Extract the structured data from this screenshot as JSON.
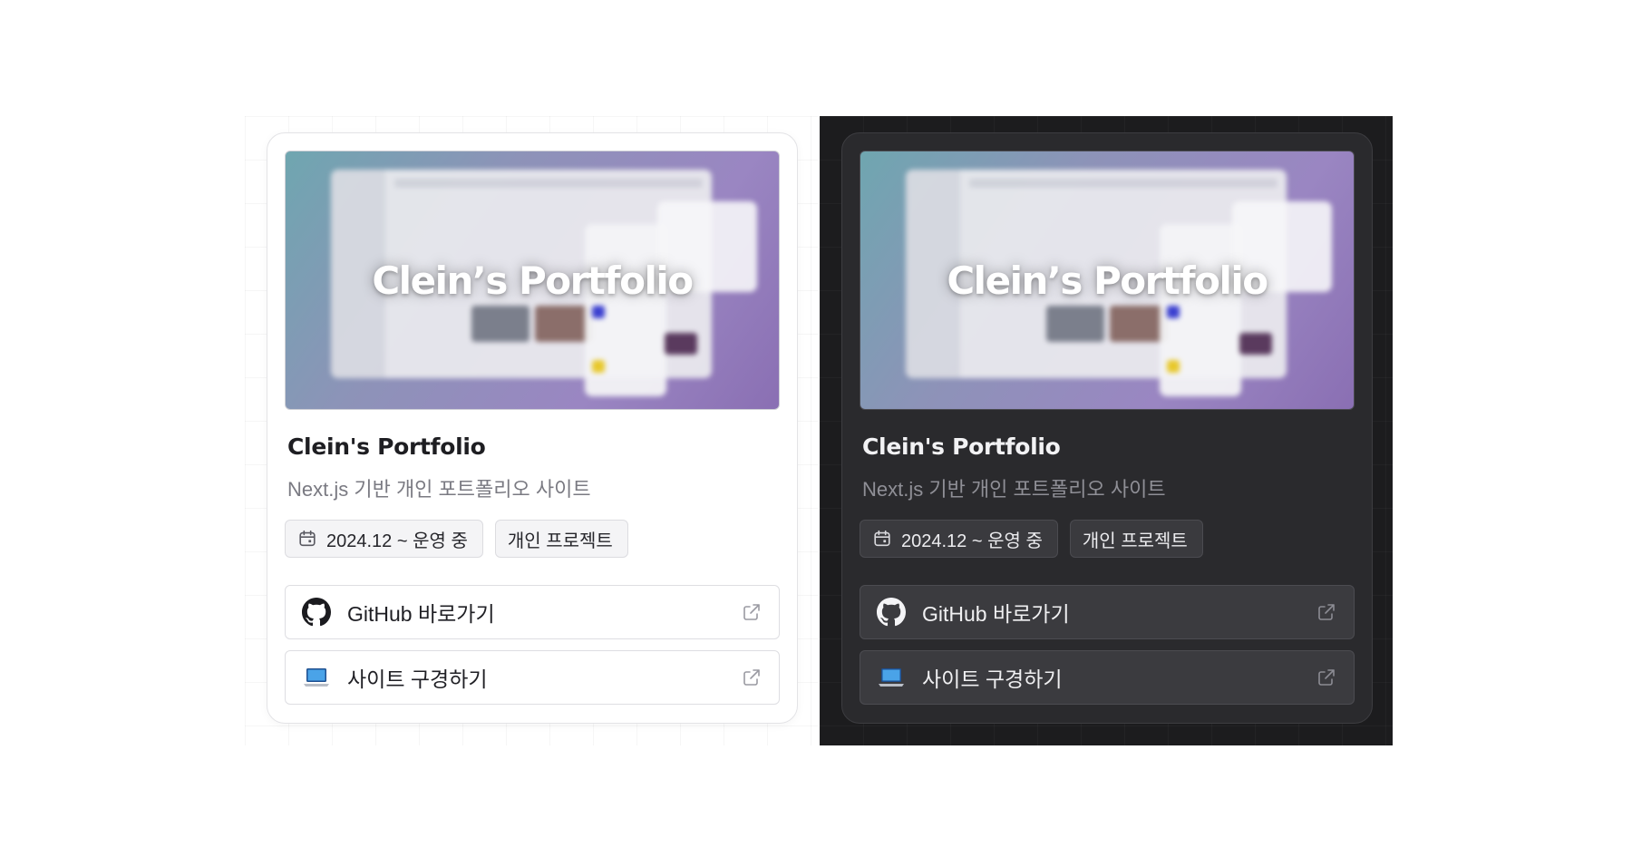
{
  "card": {
    "thumbnail_title": "Clein’s Portfolio",
    "title": "Clein's Portfolio",
    "description": "Next.js 기반 개인 포트폴리오 사이트",
    "tags": [
      "2024.12 ~ 운영 중",
      "개인 프로젝트"
    ],
    "links": [
      {
        "label": "GitHub 바로가기",
        "icon": "github-icon"
      },
      {
        "label": "사이트 구경하기",
        "icon": "laptop-icon"
      }
    ]
  },
  "themes": [
    "light",
    "dark"
  ],
  "colors": {
    "light_background": "#ffffff",
    "dark_background": "#1c1c1e",
    "dark_card": "#2a2a2d",
    "thumbnail_gradient_start": "#6fa6b0",
    "thumbnail_gradient_end": "#8a6fb3"
  }
}
